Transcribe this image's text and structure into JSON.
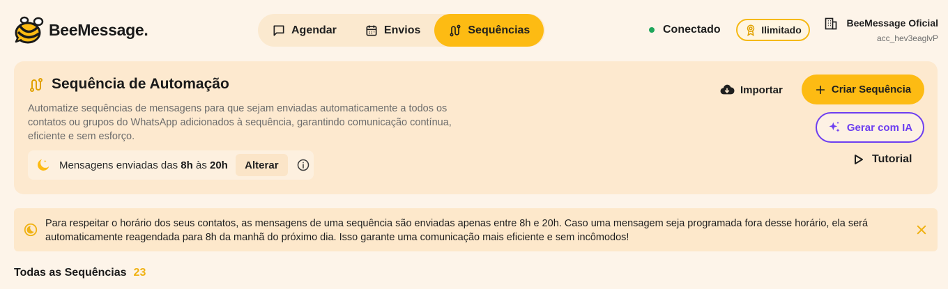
{
  "header": {
    "logo_text": "BeeMessage.",
    "nav": [
      {
        "label": "Agendar",
        "icon": "message-square-icon",
        "active": false
      },
      {
        "label": "Envios",
        "icon": "calendar-icon",
        "active": false
      },
      {
        "label": "Sequências",
        "icon": "route-icon",
        "active": true
      }
    ],
    "status_label": "Conectado",
    "plan_label": "Ilimitado",
    "account_name": "BeeMessage Oficial",
    "account_id": "acc_hev3eaglvP"
  },
  "card": {
    "title": "Sequência de Automação",
    "description": "Automatize sequências de mensagens para que sejam enviadas automaticamente a todos os contatos ou grupos do WhatsApp adicionados à sequência, garantindo comunicação contínua, eficiente e sem esforço.",
    "hours_prefix": "Mensagens enviadas das",
    "hours_start": "8h",
    "hours_mid": "às",
    "hours_end": "20h",
    "change_label": "Alterar",
    "import_label": "Importar",
    "create_label": "Criar Sequência",
    "ai_label": "Gerar com IA",
    "tutorial_label": "Tutorial"
  },
  "alert": {
    "text": "Para respeitar o horário dos seus contatos, as mensagens de uma sequência são enviadas apenas entre 8h e 20h. Caso uma mensagem seja programada fora desse horário, ela será automaticamente reagendada para 8h da manhã do próximo dia. Isso garante uma comunicação mais eficiente e sem incômodos!"
  },
  "list": {
    "title": "Todas as Sequências",
    "count": "23"
  },
  "colors": {
    "accent": "#fdbb13",
    "ai": "#6d3ef0",
    "connected": "#1fa65b"
  }
}
